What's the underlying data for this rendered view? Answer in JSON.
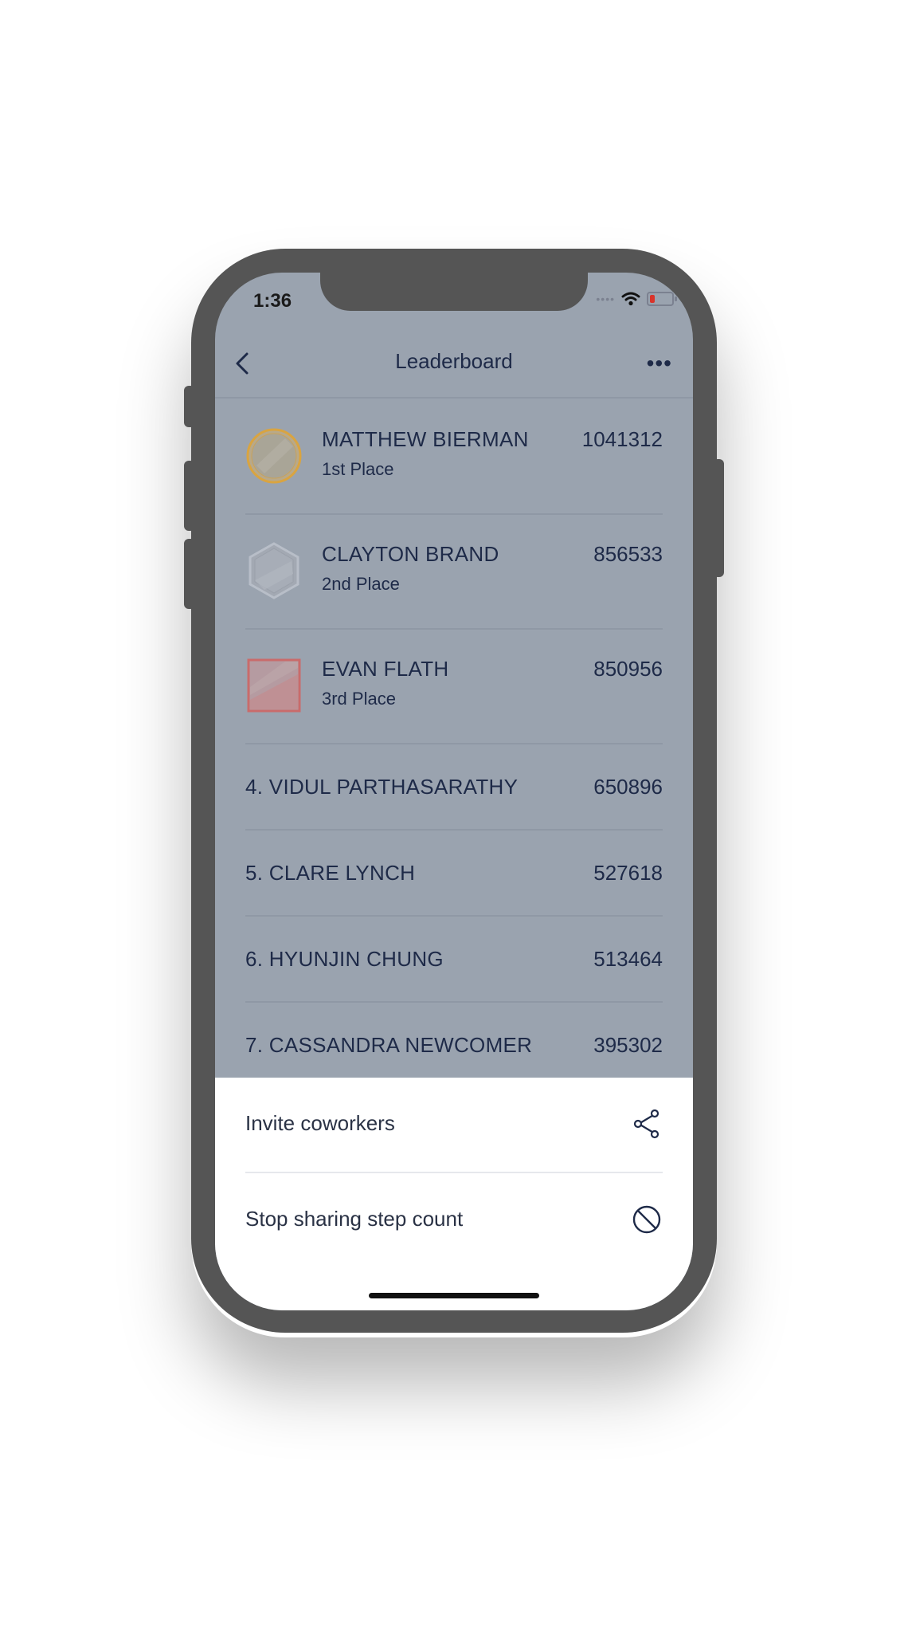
{
  "status_bar": {
    "time": "1:36",
    "signal": "••••"
  },
  "header": {
    "title": "Leaderboard",
    "back_icon": "chevron-left-icon",
    "more_label": "•••"
  },
  "podium": [
    {
      "name": "MATTHEW BIERMAN",
      "place": "1st Place",
      "score": "1041312",
      "medal": "gold-circle",
      "color": "#d9a441"
    },
    {
      "name": "CLAYTON BRAND",
      "place": "2nd Place",
      "score": "856533",
      "medal": "silver-hexagon",
      "color": "#b8bec8"
    },
    {
      "name": "EVAN FLATH",
      "place": "3rd Place",
      "score": "850956",
      "medal": "bronze-square",
      "color": "#c96b6b"
    }
  ],
  "ranks": [
    {
      "name": "4. VIDUL PARTHASARATHY",
      "score": "650896"
    },
    {
      "name": "5. CLARE LYNCH",
      "score": "527618"
    },
    {
      "name": "6. HYUNJIN CHUNG",
      "score": "513464"
    },
    {
      "name": "7. CASSANDRA NEWCOMER",
      "score": "395302"
    }
  ],
  "action_sheet": {
    "items": [
      {
        "label": "Invite coworkers",
        "icon": "share-icon"
      },
      {
        "label": "Stop sharing step count",
        "icon": "prohibited-icon"
      }
    ]
  },
  "colors": {
    "overlay": "#9aa3af",
    "text": "#1e2a48",
    "phone": "#555555"
  }
}
